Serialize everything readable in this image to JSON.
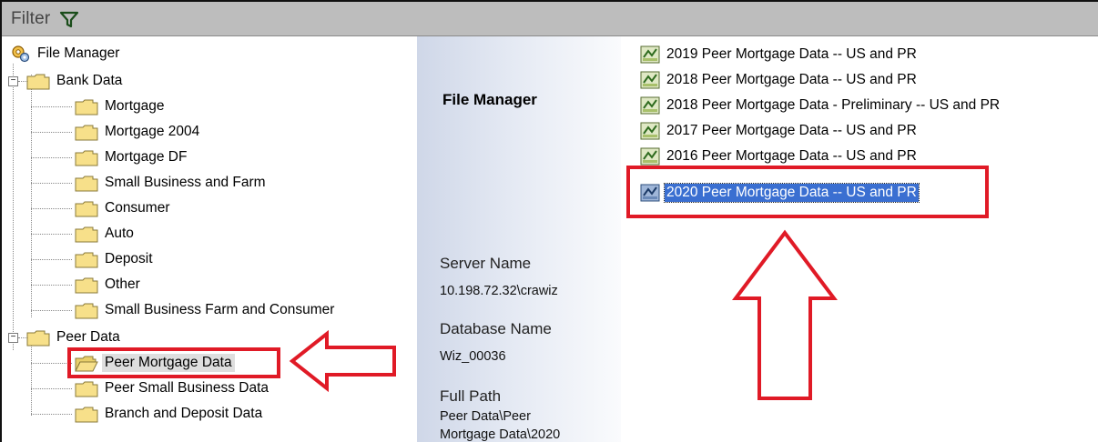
{
  "filter": {
    "label": "Filter",
    "icon": "filter-funnel-icon"
  },
  "tree": {
    "root": "File Manager",
    "groups": [
      {
        "label": "Bank Data",
        "items": [
          "Mortgage",
          "Mortgage 2004",
          "Mortgage DF",
          "Small Business and Farm",
          "Consumer",
          "Auto",
          "Deposit",
          "Other",
          "Small Business Farm and Consumer"
        ]
      },
      {
        "label": "Peer Data",
        "items": [
          "Peer Mortgage Data",
          "Peer Small Business Data",
          "Branch and Deposit Data"
        ]
      }
    ],
    "selected": "Peer Mortgage Data"
  },
  "details": {
    "title": "File Manager",
    "server_label": "Server Name",
    "server_value": "10.198.72.32\\crawiz",
    "database_label": "Database Name",
    "database_value": "Wiz_00036",
    "path_label": "Full Path",
    "path_line1": "Peer Data\\Peer",
    "path_line2": "Mortgage Data\\2020"
  },
  "files": [
    "2019 Peer Mortgage Data -- US and PR",
    "2018 Peer Mortgage Data -- US and PR",
    "2018 Peer Mortgage Data - Preliminary -- US and PR",
    "2017 Peer Mortgage Data -- US and PR",
    "2016 Peer Mortgage Data -- US and PR",
    "2020 Peer Mortgage Data -- US and PR"
  ],
  "selected_file": "2020 Peer Mortgage Data -- US and PR",
  "colors": {
    "highlight_red": "#e01a26",
    "selection_blue": "#3a6fd1",
    "filter_bar": "#bdbdbd",
    "folder_yellow": "#f7e08a"
  }
}
